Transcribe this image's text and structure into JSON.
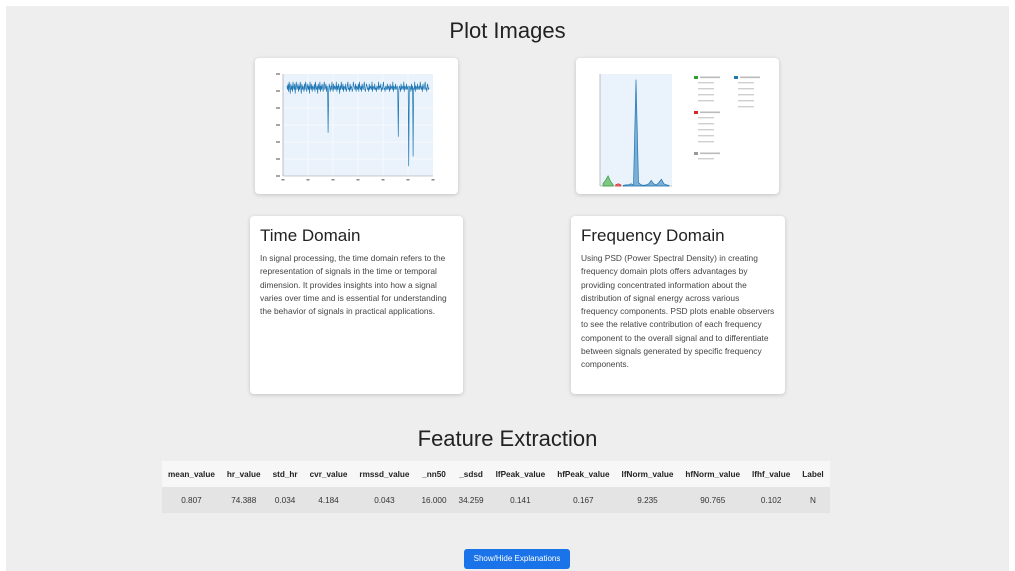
{
  "plot_section": {
    "title": "Plot Images"
  },
  "plots": [
    {
      "name": "time-domain",
      "chart_data": {
        "type": "line",
        "title": "",
        "series": [
          {
            "values": [
              86,
              84,
              87,
              83,
              88,
              85,
              82,
              87,
              84,
              86,
              83,
              88,
              85,
              84,
              87,
              82,
              86,
              88,
              84,
              85,
              87,
              83,
              86,
              84,
              88,
              85,
              82,
              87,
              84,
              86,
              85,
              83,
              87,
              84,
              88,
              86,
              83,
              85,
              87,
              84,
              86,
              82,
              88,
              85,
              84,
              87,
              83,
              86,
              85,
              84,
              87,
              83,
              88,
              85,
              84,
              86,
              82,
              87,
              85,
              84,
              88,
              83,
              86,
              84,
              87,
              85,
              83,
              86,
              88,
              84,
              85,
              87,
              83,
              86,
              84,
              62,
              84,
              87,
              85,
              83,
              86,
              84,
              88,
              85,
              83,
              87,
              84,
              86,
              85,
              84,
              88,
              83,
              86,
              84,
              87,
              85,
              82,
              86,
              84,
              88,
              85,
              84,
              87,
              83,
              86,
              85,
              84,
              87,
              83,
              84,
              86,
              88,
              84,
              85,
              83,
              87,
              84,
              86,
              85,
              83,
              84,
              88,
              86,
              85,
              84,
              87,
              83,
              86,
              85,
              84,
              87,
              83,
              88,
              85,
              84,
              86,
              83,
              87,
              85,
              84,
              86,
              88,
              84,
              83,
              85,
              87,
              86,
              84,
              85,
              83,
              87,
              84,
              86,
              85,
              84,
              88,
              83,
              86,
              85,
              84,
              87,
              84,
              85,
              83,
              86,
              85,
              84,
              88,
              84,
              86,
              85,
              87,
              83,
              85,
              84,
              86,
              88,
              84,
              85,
              83,
              86,
              85,
              84,
              87,
              84,
              86,
              85,
              83,
              87,
              84,
              86,
              85,
              84,
              88,
              83,
              86,
              85,
              84,
              87,
              84,
              85,
              86,
              84,
              60,
              84,
              86,
              85,
              83,
              87,
              84,
              86,
              85,
              84,
              88,
              83,
              86,
              85,
              84,
              87,
              84,
              85,
              86,
              45,
              84,
              86,
              85,
              83,
              87,
              84,
              86,
              50,
              85,
              84,
              88,
              83,
              86,
              85,
              84,
              87,
              84,
              85,
              86,
              84,
              88,
              85,
              84,
              86,
              83,
              87,
              85,
              84,
              86,
              88,
              84,
              85,
              83,
              87,
              86,
              84,
              85
            ]
          }
        ]
      }
    },
    {
      "name": "frequency-domain",
      "chart_data": {
        "type": "area",
        "title": "",
        "series": [
          {
            "name": "",
            "color": "#2ca02c",
            "values": [
              2,
              5,
              9,
              4,
              1
            ]
          },
          {
            "name": "",
            "color": "#d62728",
            "values": [
              1,
              2,
              1
            ]
          },
          {
            "name": "",
            "color": "#1f77b4",
            "values": [
              0.5,
              1,
              1,
              2,
              1,
              95,
              3,
              1,
              0.5,
              1,
              2,
              5,
              2,
              1,
              3,
              6,
              2,
              1,
              0.5
            ]
          }
        ]
      }
    }
  ],
  "cards": [
    {
      "title": "Time Domain",
      "text": "In signal processing, the time domain refers to the representation of signals in the time or temporal dimension. It provides insights into how a signal varies over time and is essential for understanding the behavior of signals in practical applications."
    },
    {
      "title": "Frequency Domain",
      "text": "Using PSD (Power Spectral Density) in creating frequency domain plots offers advantages by providing concentrated information about the distribution of signal energy across various frequency components. PSD plots enable observers to see the relative contribution of each frequency component to the overall signal and to differentiate between signals generated by specific frequency components."
    }
  ],
  "features": {
    "title": "Feature Extraction",
    "headers": [
      "mean_value",
      "hr_value",
      "std_hr",
      "cvr_value",
      "rmssd_value",
      "_nn50",
      "_sdsd",
      "lfPeak_value",
      "hfPeak_value",
      "lfNorm_value",
      "hfNorm_value",
      "lfhf_value",
      "Label"
    ],
    "row": [
      "0.807",
      "74.388",
      "0.034",
      "4.184",
      "0.043",
      "16.000",
      "34.259",
      "0.141",
      "0.167",
      "9.235",
      "90.765",
      "0.102",
      "N"
    ]
  },
  "toggle_button": {
    "label": "Show/Hide Explanations"
  }
}
